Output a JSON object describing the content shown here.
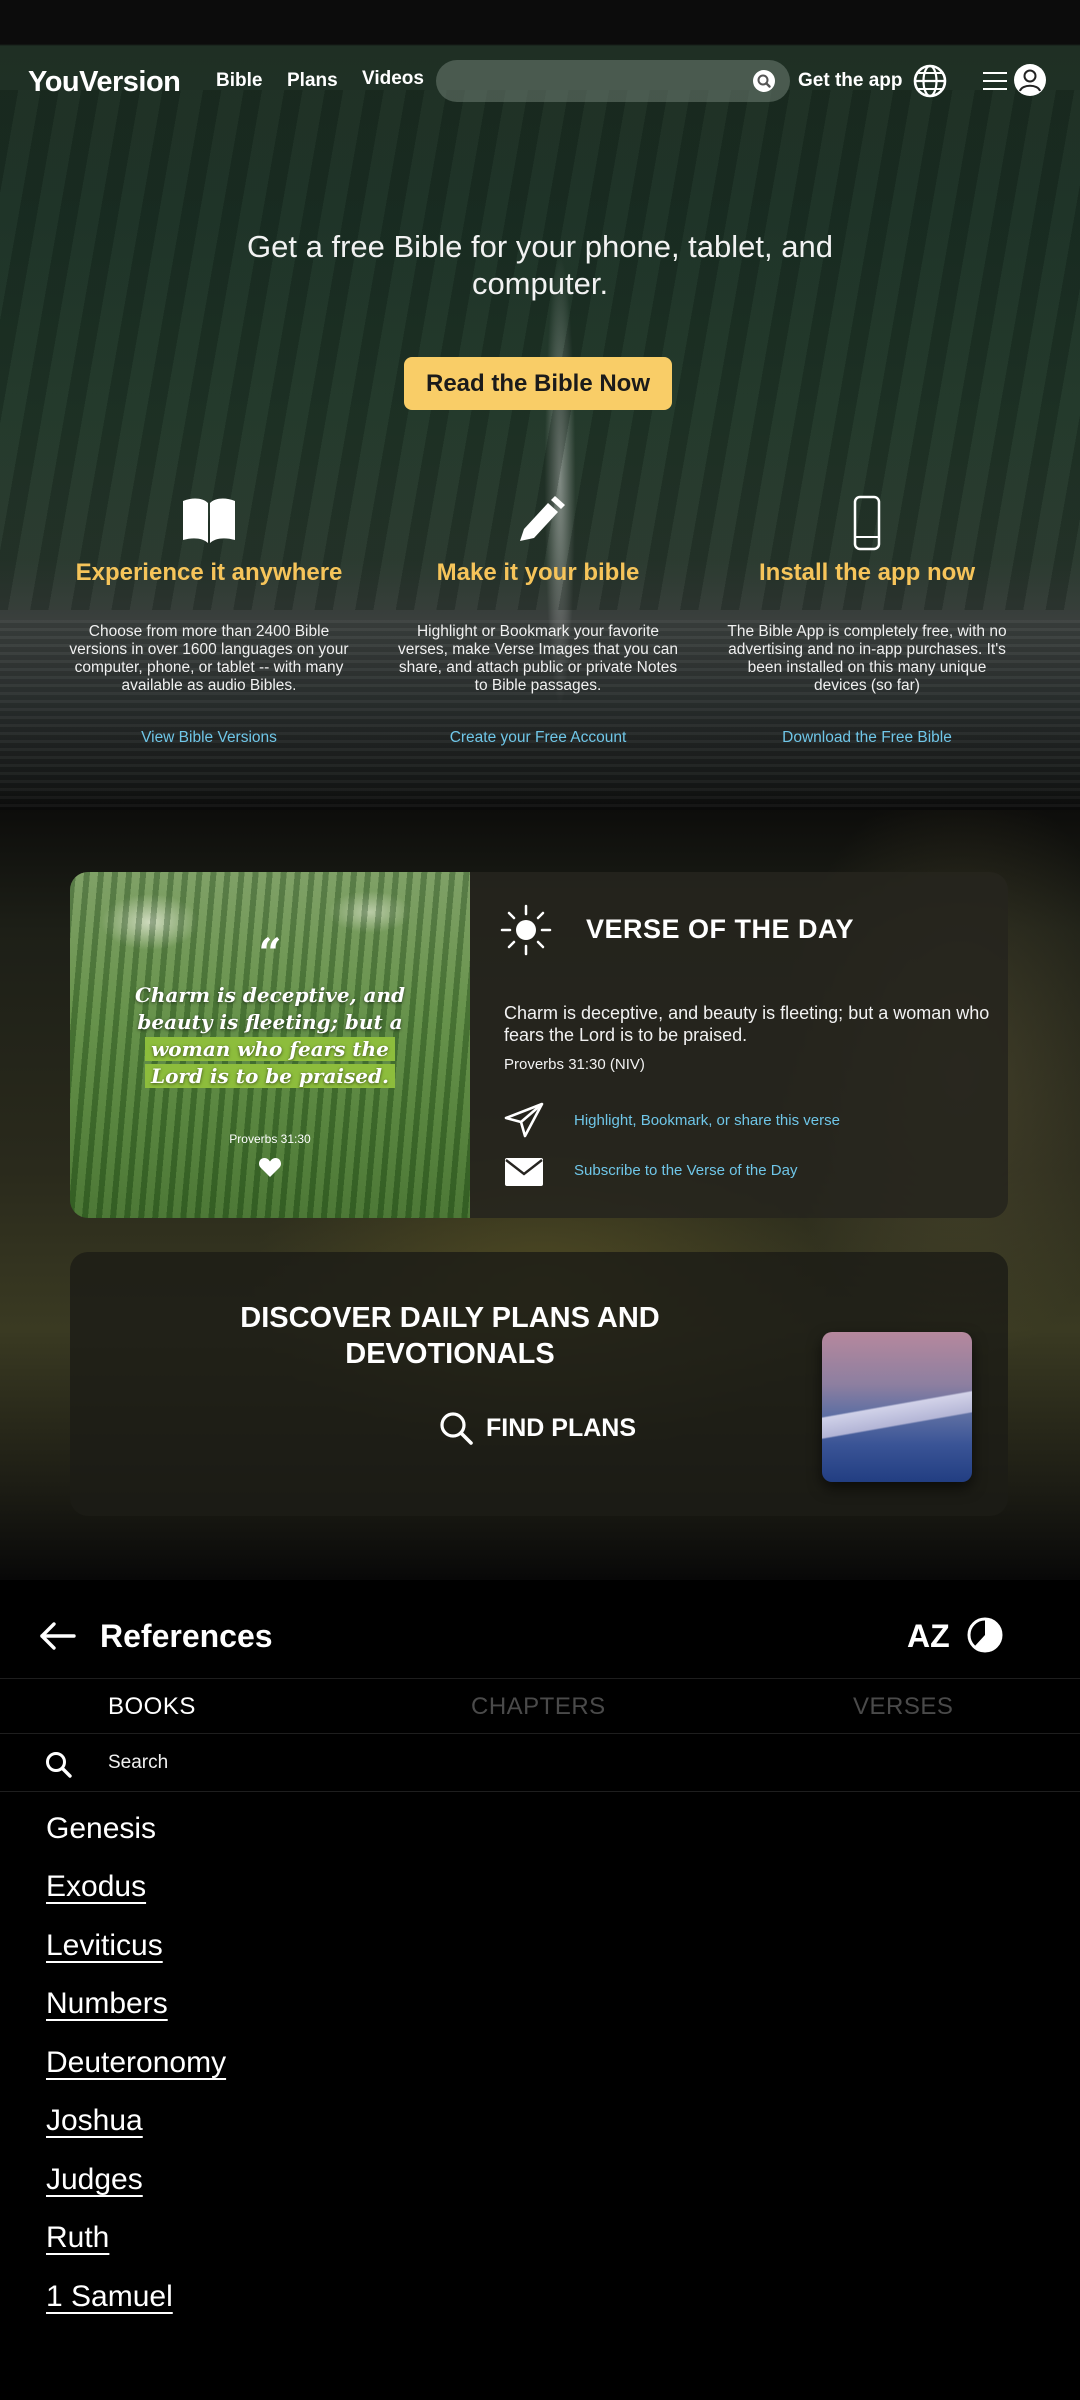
{
  "nav": {
    "logo": "YouVersion",
    "links": [
      "Bible",
      "Plans",
      "Videos"
    ],
    "get_app": "Get the app"
  },
  "hero": {
    "title": "Get a free Bible for your phone, tablet, and computer.",
    "cta": "Read the Bible Now"
  },
  "features": [
    {
      "icon": "open-book-icon",
      "title": "Experience it anywhere",
      "description": "Choose from more than 2400 Bible versions in over 1600 languages on your computer, phone, or tablet -- with many available as audio Bibles.",
      "link": "View Bible Versions"
    },
    {
      "icon": "pencil-icon",
      "title": "Make it your bible",
      "description": "Highlight or Bookmark your favorite verses, make Verse Images that you can share, and attach public or private Notes to Bible passages.",
      "link": "Create your Free Account"
    },
    {
      "icon": "phone-icon",
      "title": "Install the app now",
      "description": "The Bible App is completely free, with no advertising and no in-app purchases. It's been installed on this many unique devices (so far)",
      "link": "Download the Free Bible"
    }
  ],
  "votd": {
    "title": "VERSE OF THE DAY",
    "image_quote_mark": "“",
    "image_line_1": "Charm is deceptive, and beauty is fleeting; but a",
    "image_line_2": "woman who fears the",
    "image_line_3": "Lord is to be praised.",
    "image_reference": "Proverbs 31:30",
    "text": "Charm is deceptive, and beauty is fleeting; but a woman who fears the Lord is to be praised.",
    "reference": "Proverbs 31:30 (NIV)",
    "action_share": "Highlight, Bookmark, or share this verse",
    "action_subscribe": "Subscribe to the Verse of the Day"
  },
  "plans": {
    "title": "DISCOVER DAILY PLANS AND DEVOTIONALS",
    "find": "FIND PLANS"
  },
  "references": {
    "title": "References",
    "sort_label": "AZ",
    "tabs": [
      "BOOKS",
      "CHAPTERS",
      "VERSES"
    ],
    "active_tab": "BOOKS",
    "search_placeholder": "Search",
    "books": [
      "Genesis",
      "Exodus",
      "Leviticus",
      "Numbers",
      "Deuteronomy",
      "Joshua",
      "Judges",
      "Ruth",
      "1 Samuel"
    ]
  },
  "colors": {
    "accent_yellow": "#f9cd67",
    "feature_title": "#f6c45a",
    "link_blue": "#6fc6e8",
    "tab_inactive": "#4a4a4a"
  }
}
